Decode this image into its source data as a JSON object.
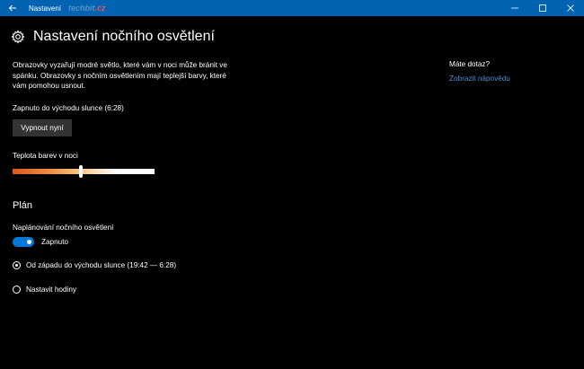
{
  "titlebar": {
    "title": "Nastavení",
    "watermark_main": "techbit",
    "watermark_suffix": ".cz",
    "back_icon": "back-arrow-icon",
    "minimize_glyph": "—",
    "maximize_glyph": "☐",
    "close_glyph": "✕",
    "bg_color": "#0063b1"
  },
  "page": {
    "title": "Nastavení nočního osvětlení",
    "icon": "gear-icon"
  },
  "description": "Obrazovky vyzařují modré světlo, které vám v noci může bránit ve spánku. Obrazovky s nočním osvětlením mají teplejší barvy, které vám pomohou usnout.",
  "status_text": "Zapnuto do východu slunce (6:28)",
  "turn_off_button": "Vypnout nyní",
  "color_temperature": {
    "label": "Teplota barev v noci",
    "value_fraction": 0.48
  },
  "schedule": {
    "section_title": "Plán",
    "label": "Naplánování nočního osvětlení",
    "toggle_state": "Zapnuto",
    "toggle_on": true,
    "accent_color": "#0078d7",
    "options": [
      {
        "label": "Od západu do východu slunce (19:42 — 6:28)",
        "selected": true
      },
      {
        "label": "Nastavit hodiny",
        "selected": false
      }
    ]
  },
  "sidebar": {
    "question": "Máte dotaz?",
    "help_link": "Zobrazit nápovědu",
    "link_color": "#4a8fd9"
  }
}
